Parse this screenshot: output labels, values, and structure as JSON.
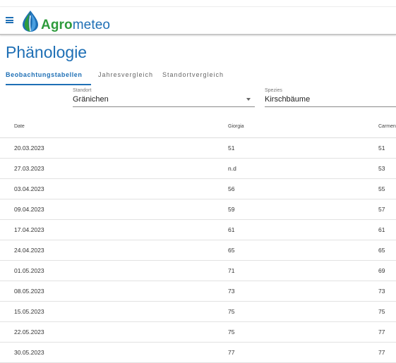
{
  "app": {
    "brand_part1": "Agro",
    "brand_part2": "meteo",
    "menu_icon": "hamburger-menu-icon",
    "logo_icon": "leaf-drop-logo-icon",
    "colors": {
      "primary": "#1e6fb5",
      "brand_green": "#2e9b3c"
    }
  },
  "page": {
    "title": "Phänologie"
  },
  "tabs": [
    {
      "label": "Beobachtungstabellen",
      "active": true
    },
    {
      "label": "Jahresvergleich",
      "active": false
    },
    {
      "label": "Standortvergleich",
      "active": false
    }
  ],
  "filters": {
    "standort": {
      "label": "Standort",
      "value": "Gränichen",
      "icon": "dropdown-caret-icon"
    },
    "spezies": {
      "label": "Spezies",
      "value": "Kirschbäume"
    }
  },
  "table": {
    "columns": [
      "Date",
      "Giorgia",
      "Carmen"
    ],
    "rows": [
      [
        "20.03.2023",
        "51",
        "51"
      ],
      [
        "27.03.2023",
        "n.d",
        "53"
      ],
      [
        "03.04.2023",
        "56",
        "55"
      ],
      [
        "09.04.2023",
        "59",
        "57"
      ],
      [
        "17.04.2023",
        "61",
        "61"
      ],
      [
        "24.04.2023",
        "65",
        "65"
      ],
      [
        "01.05.2023",
        "71",
        "69"
      ],
      [
        "08.05.2023",
        "73",
        "73"
      ],
      [
        "15.05.2023",
        "75",
        "75"
      ],
      [
        "22.05.2023",
        "75",
        "77"
      ],
      [
        "30.05.2023",
        "77",
        "77"
      ]
    ]
  }
}
